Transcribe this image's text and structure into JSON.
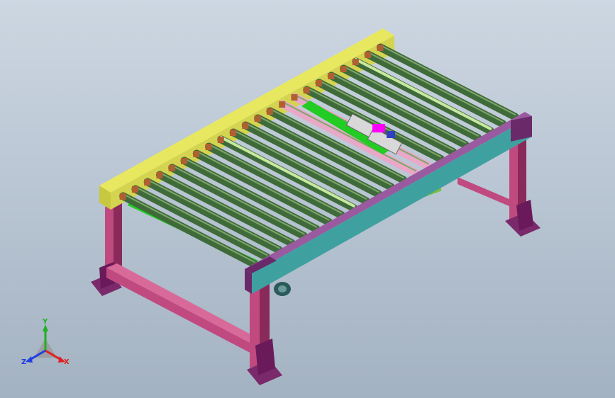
{
  "viewport": {
    "background_top": "#cdd7e2",
    "background_bottom": "#a3b2c2"
  },
  "model": {
    "roller_count": 22,
    "colors": {
      "roller": "#3f6b3a",
      "roller_highlight": "#7fa66a",
      "roller_light": "#c8e8a0",
      "roller_pink": "#e9a8c8",
      "side_rail_top": "#e8e860",
      "side_rail_front": "#c8c840",
      "rail_teal": "#3fa0a0",
      "rail_purple": "#6a2a6a",
      "frame": "#c04a80",
      "frame_dark": "#8a2a5a",
      "foot": "#7a2a6a",
      "green_belt": "#22cc22",
      "cylinder": "#d8d8d8",
      "magenta": "#ff00ff",
      "motor": "#7ac040"
    }
  },
  "triad": {
    "x_label": "X",
    "y_label": "Y",
    "z_label": "Z",
    "x_color": "#e02020",
    "y_color": "#20b020",
    "z_color": "#2040e0"
  }
}
